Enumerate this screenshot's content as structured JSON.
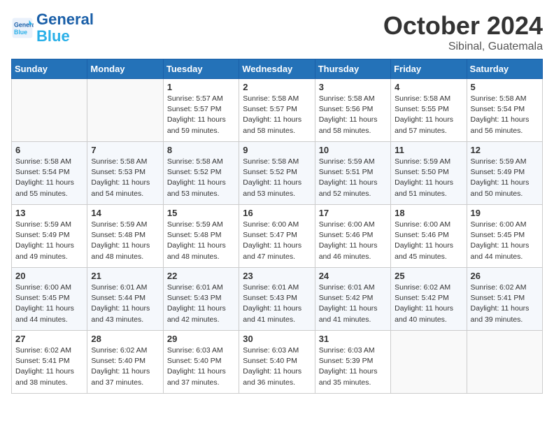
{
  "header": {
    "logo_general": "General",
    "logo_blue": "Blue",
    "month_title": "October 2024",
    "location": "Sibinal, Guatemala"
  },
  "weekdays": [
    "Sunday",
    "Monday",
    "Tuesday",
    "Wednesday",
    "Thursday",
    "Friday",
    "Saturday"
  ],
  "weeks": [
    [
      {
        "day": "",
        "info": ""
      },
      {
        "day": "",
        "info": ""
      },
      {
        "day": "1",
        "info": "Sunrise: 5:57 AM\nSunset: 5:57 PM\nDaylight: 11 hours and 59 minutes."
      },
      {
        "day": "2",
        "info": "Sunrise: 5:58 AM\nSunset: 5:57 PM\nDaylight: 11 hours and 58 minutes."
      },
      {
        "day": "3",
        "info": "Sunrise: 5:58 AM\nSunset: 5:56 PM\nDaylight: 11 hours and 58 minutes."
      },
      {
        "day": "4",
        "info": "Sunrise: 5:58 AM\nSunset: 5:55 PM\nDaylight: 11 hours and 57 minutes."
      },
      {
        "day": "5",
        "info": "Sunrise: 5:58 AM\nSunset: 5:54 PM\nDaylight: 11 hours and 56 minutes."
      }
    ],
    [
      {
        "day": "6",
        "info": "Sunrise: 5:58 AM\nSunset: 5:54 PM\nDaylight: 11 hours and 55 minutes."
      },
      {
        "day": "7",
        "info": "Sunrise: 5:58 AM\nSunset: 5:53 PM\nDaylight: 11 hours and 54 minutes."
      },
      {
        "day": "8",
        "info": "Sunrise: 5:58 AM\nSunset: 5:52 PM\nDaylight: 11 hours and 53 minutes."
      },
      {
        "day": "9",
        "info": "Sunrise: 5:58 AM\nSunset: 5:52 PM\nDaylight: 11 hours and 53 minutes."
      },
      {
        "day": "10",
        "info": "Sunrise: 5:59 AM\nSunset: 5:51 PM\nDaylight: 11 hours and 52 minutes."
      },
      {
        "day": "11",
        "info": "Sunrise: 5:59 AM\nSunset: 5:50 PM\nDaylight: 11 hours and 51 minutes."
      },
      {
        "day": "12",
        "info": "Sunrise: 5:59 AM\nSunset: 5:49 PM\nDaylight: 11 hours and 50 minutes."
      }
    ],
    [
      {
        "day": "13",
        "info": "Sunrise: 5:59 AM\nSunset: 5:49 PM\nDaylight: 11 hours and 49 minutes."
      },
      {
        "day": "14",
        "info": "Sunrise: 5:59 AM\nSunset: 5:48 PM\nDaylight: 11 hours and 48 minutes."
      },
      {
        "day": "15",
        "info": "Sunrise: 5:59 AM\nSunset: 5:48 PM\nDaylight: 11 hours and 48 minutes."
      },
      {
        "day": "16",
        "info": "Sunrise: 6:00 AM\nSunset: 5:47 PM\nDaylight: 11 hours and 47 minutes."
      },
      {
        "day": "17",
        "info": "Sunrise: 6:00 AM\nSunset: 5:46 PM\nDaylight: 11 hours and 46 minutes."
      },
      {
        "day": "18",
        "info": "Sunrise: 6:00 AM\nSunset: 5:46 PM\nDaylight: 11 hours and 45 minutes."
      },
      {
        "day": "19",
        "info": "Sunrise: 6:00 AM\nSunset: 5:45 PM\nDaylight: 11 hours and 44 minutes."
      }
    ],
    [
      {
        "day": "20",
        "info": "Sunrise: 6:00 AM\nSunset: 5:45 PM\nDaylight: 11 hours and 44 minutes."
      },
      {
        "day": "21",
        "info": "Sunrise: 6:01 AM\nSunset: 5:44 PM\nDaylight: 11 hours and 43 minutes."
      },
      {
        "day": "22",
        "info": "Sunrise: 6:01 AM\nSunset: 5:43 PM\nDaylight: 11 hours and 42 minutes."
      },
      {
        "day": "23",
        "info": "Sunrise: 6:01 AM\nSunset: 5:43 PM\nDaylight: 11 hours and 41 minutes."
      },
      {
        "day": "24",
        "info": "Sunrise: 6:01 AM\nSunset: 5:42 PM\nDaylight: 11 hours and 41 minutes."
      },
      {
        "day": "25",
        "info": "Sunrise: 6:02 AM\nSunset: 5:42 PM\nDaylight: 11 hours and 40 minutes."
      },
      {
        "day": "26",
        "info": "Sunrise: 6:02 AM\nSunset: 5:41 PM\nDaylight: 11 hours and 39 minutes."
      }
    ],
    [
      {
        "day": "27",
        "info": "Sunrise: 6:02 AM\nSunset: 5:41 PM\nDaylight: 11 hours and 38 minutes."
      },
      {
        "day": "28",
        "info": "Sunrise: 6:02 AM\nSunset: 5:40 PM\nDaylight: 11 hours and 37 minutes."
      },
      {
        "day": "29",
        "info": "Sunrise: 6:03 AM\nSunset: 5:40 PM\nDaylight: 11 hours and 37 minutes."
      },
      {
        "day": "30",
        "info": "Sunrise: 6:03 AM\nSunset: 5:40 PM\nDaylight: 11 hours and 36 minutes."
      },
      {
        "day": "31",
        "info": "Sunrise: 6:03 AM\nSunset: 5:39 PM\nDaylight: 11 hours and 35 minutes."
      },
      {
        "day": "",
        "info": ""
      },
      {
        "day": "",
        "info": ""
      }
    ]
  ]
}
